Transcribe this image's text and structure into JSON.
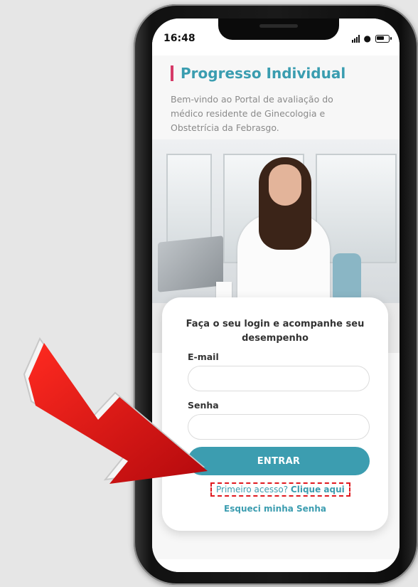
{
  "status_bar": {
    "time": "16:48"
  },
  "page": {
    "section_title": "Progresso Individual",
    "intro": "Bem-vindo ao Portal de avaliação do médico residente de Ginecologia e Obstetrícia da Febrasgo."
  },
  "login": {
    "title": "Faça o seu login e acompanhe seu desempenho",
    "email_label": "E-mail",
    "email_value": "",
    "password_label": "Senha",
    "password_value": "",
    "submit_label": "ENTRAR",
    "first_access_text": "Primeiro acesso?",
    "first_access_link": "Clique aqui",
    "forgot_label": "Esqueci minha Senha"
  },
  "colors": {
    "accent": "#3c9db0",
    "title_bar": "#d63a68",
    "highlight": "#e0191f",
    "arrow": "#d10f14"
  }
}
